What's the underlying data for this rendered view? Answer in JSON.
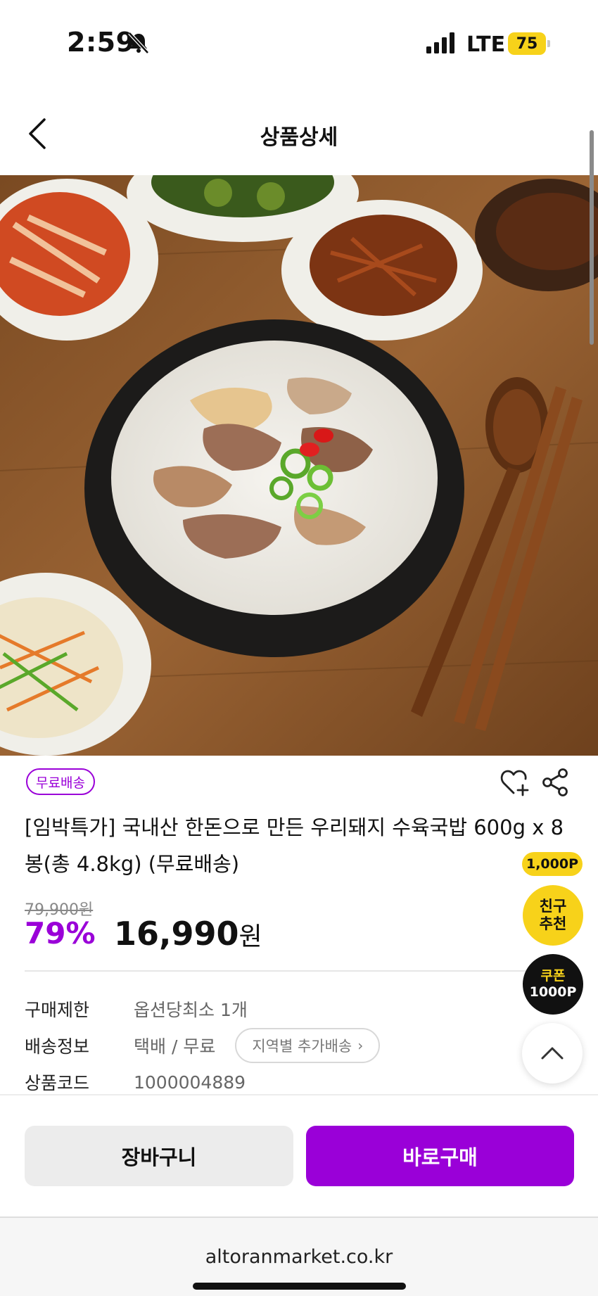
{
  "status_bar": {
    "time": "2:59",
    "network": "LTE",
    "battery": "75",
    "battery_color": "#f7d21a"
  },
  "header": {
    "title": "상품상세",
    "back_icon": "chevron-left-icon"
  },
  "product": {
    "badge": "무료배송",
    "title": "[임박특가] 국내산 한돈으로 만든 우리돼지 수육국밥 600g x 8봉(총 4.8kg) (무료배송)",
    "original_price": "79,900원",
    "discount": "79%",
    "price": "16,990",
    "price_unit": "원",
    "accent_color": "#9a00d8"
  },
  "info": {
    "limit_label": "구매제한",
    "limit_value": "옵션당최소 1개",
    "shipping_label": "배송정보",
    "shipping_value": "택배 / 무료",
    "region_button": "지역별 추가배송",
    "code_label": "상품코드",
    "code_value": "1000004889"
  },
  "floating": {
    "point_badge": "1,000P",
    "friend_line1": "친구",
    "friend_line2": "추천",
    "coupon_line1": "쿠폰",
    "coupon_line2": "1000P"
  },
  "actions": {
    "cart": "장바구니",
    "buy": "바로구매"
  },
  "browser": {
    "url": "altoranmarket.co.kr"
  }
}
